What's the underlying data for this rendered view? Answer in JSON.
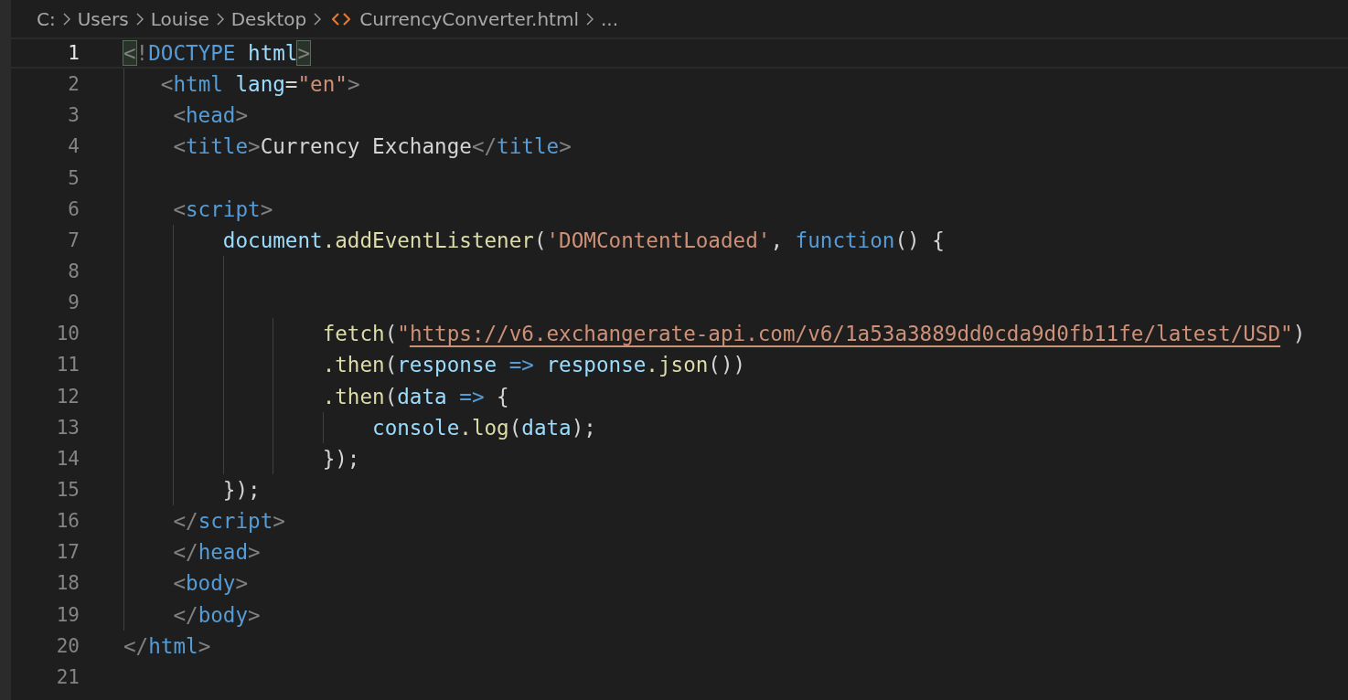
{
  "breadcrumb": [
    {
      "kind": "folder",
      "label": "C:"
    },
    {
      "kind": "folder",
      "label": "Users"
    },
    {
      "kind": "folder",
      "label": "Louise"
    },
    {
      "kind": "folder",
      "label": "Desktop"
    },
    {
      "kind": "file",
      "label": "CurrencyConverter.html"
    },
    {
      "kind": "more",
      "label": "..."
    }
  ],
  "lines": [
    {
      "number": "1",
      "current": true,
      "tokens": [
        {
          "kind": "match",
          "text": "<"
        },
        {
          "kind": "punct",
          "text": "!"
        },
        {
          "kind": "tag",
          "text": "DOCTYPE"
        },
        {
          "kind": "attr",
          "text": " html"
        },
        {
          "kind": "match",
          "text": ">"
        }
      ]
    },
    {
      "number": "2",
      "current": false,
      "tokens": [
        {
          "kind": "punct",
          "text": "   <"
        },
        {
          "kind": "tag",
          "text": "html"
        },
        {
          "kind": "attr",
          "text": " lang"
        },
        {
          "kind": "text",
          "text": "="
        },
        {
          "kind": "string",
          "text": "\"en\""
        },
        {
          "kind": "punct",
          "text": ">"
        }
      ]
    },
    {
      "number": "3",
      "current": false,
      "tokens": [
        {
          "kind": "punct",
          "text": "    <"
        },
        {
          "kind": "tag",
          "text": "head"
        },
        {
          "kind": "punct",
          "text": ">"
        }
      ]
    },
    {
      "number": "4",
      "current": false,
      "tokens": [
        {
          "kind": "punct",
          "text": "    <"
        },
        {
          "kind": "tag",
          "text": "title"
        },
        {
          "kind": "punct",
          "text": ">"
        },
        {
          "kind": "text",
          "text": "Currency Exchange"
        },
        {
          "kind": "punct",
          "text": "</"
        },
        {
          "kind": "tag",
          "text": "title"
        },
        {
          "kind": "punct",
          "text": ">"
        }
      ]
    },
    {
      "number": "5",
      "current": false
    },
    {
      "number": "6",
      "current": false,
      "tokens": [
        {
          "kind": "punct",
          "text": "    <"
        },
        {
          "kind": "tag",
          "text": "script"
        },
        {
          "kind": "punct",
          "text": ">"
        }
      ]
    },
    {
      "number": "7",
      "current": false,
      "tokens": [
        {
          "kind": "var",
          "text": "        document"
        },
        {
          "kind": "func",
          "text": ".addEventListener"
        },
        {
          "kind": "text",
          "text": "("
        },
        {
          "kind": "string",
          "text": "'DOMContentLoaded'"
        },
        {
          "kind": "text",
          "text": ","
        },
        {
          "kind": "keyword",
          "text": " function"
        },
        {
          "kind": "text",
          "text": "() {"
        }
      ]
    },
    {
      "number": "8",
      "current": false
    },
    {
      "number": "9",
      "current": false
    },
    {
      "number": "10",
      "current": false,
      "tokens": [
        {
          "kind": "func",
          "text": "                fetch"
        },
        {
          "kind": "text",
          "text": "("
        },
        {
          "kind": "string",
          "text": "\""
        },
        {
          "kind": "link",
          "text": "https://v6.exchangerate-api.com/v6/1a53a3889dd0cda9d0fb11fe/latest/USD"
        },
        {
          "kind": "string",
          "text": "\""
        },
        {
          "kind": "text",
          "text": ")"
        }
      ]
    },
    {
      "number": "11",
      "current": false,
      "tokens": [
        {
          "kind": "func",
          "text": "                .then"
        },
        {
          "kind": "text",
          "text": "("
        },
        {
          "kind": "var",
          "text": "response"
        },
        {
          "kind": "keyword",
          "text": " => "
        },
        {
          "kind": "var",
          "text": "response"
        },
        {
          "kind": "func",
          "text": ".json"
        },
        {
          "kind": "text",
          "text": "())"
        }
      ]
    },
    {
      "number": "12",
      "current": false,
      "tokens": [
        {
          "kind": "func",
          "text": "                .then"
        },
        {
          "kind": "text",
          "text": "("
        },
        {
          "kind": "var",
          "text": "data"
        },
        {
          "kind": "keyword",
          "text": " => "
        },
        {
          "kind": "text",
          "text": "{"
        }
      ]
    },
    {
      "number": "13",
      "current": false,
      "tokens": [
        {
          "kind": "var",
          "text": "                    console"
        },
        {
          "kind": "func",
          "text": ".log"
        },
        {
          "kind": "text",
          "text": "("
        },
        {
          "kind": "var",
          "text": "data"
        },
        {
          "kind": "text",
          "text": ");"
        }
      ]
    },
    {
      "number": "14",
      "current": false,
      "tokens": [
        {
          "kind": "text",
          "text": "                });"
        }
      ]
    },
    {
      "number": "15",
      "current": false,
      "tokens": [
        {
          "kind": "text",
          "text": "        });"
        }
      ]
    },
    {
      "number": "16",
      "current": false,
      "tokens": [
        {
          "kind": "punct",
          "text": "    </"
        },
        {
          "kind": "tag",
          "text": "script"
        },
        {
          "kind": "punct",
          "text": ">"
        }
      ]
    },
    {
      "number": "17",
      "current": false,
      "tokens": [
        {
          "kind": "punct",
          "text": "    </"
        },
        {
          "kind": "tag",
          "text": "head"
        },
        {
          "kind": "punct",
          "text": ">"
        }
      ]
    },
    {
      "number": "18",
      "current": false,
      "tokens": [
        {
          "kind": "punct",
          "text": "    <"
        },
        {
          "kind": "tag",
          "text": "body"
        },
        {
          "kind": "punct",
          "text": ">"
        }
      ]
    },
    {
      "number": "19",
      "current": false,
      "tokens": [
        {
          "kind": "punct",
          "text": "    </"
        },
        {
          "kind": "tag",
          "text": "body"
        },
        {
          "kind": "punct",
          "text": ">"
        }
      ]
    },
    {
      "number": "20",
      "current": false,
      "tokens": [
        {
          "kind": "punct",
          "text": "</"
        },
        {
          "kind": "tag",
          "text": "html"
        },
        {
          "kind": "punct",
          "text": ">"
        }
      ]
    },
    {
      "number": "21",
      "current": false
    }
  ]
}
